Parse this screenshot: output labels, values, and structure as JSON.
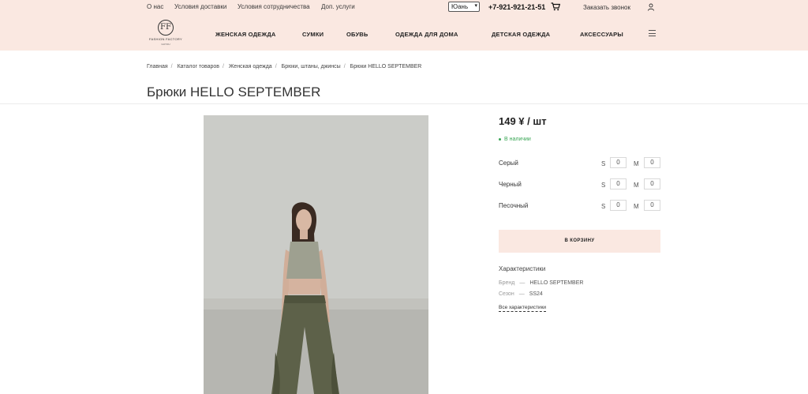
{
  "topbar": {
    "links": [
      "О нас",
      "Условия доставки",
      "Условия сотрудничества",
      "Доп. услуги"
    ],
    "currency": "Юань",
    "phone": "+7-921-921-21-51",
    "callback": "Заказать звонок"
  },
  "logo": {
    "mark": "FF",
    "name": "FASHION FACTORY",
    "sub": "GUYOU"
  },
  "nav": {
    "items": [
      "ЖЕНСКАЯ ОДЕЖДА",
      "СУМКИ",
      "ОБУВЬ",
      "ОДЕЖДА ДЛЯ ДОМА",
      "ДЕТСКАЯ ОДЕЖДА",
      "АКСЕССУАРЫ"
    ]
  },
  "breadcrumb": [
    "Главная",
    "Каталог товаров",
    "Женская одежда",
    "Брюки, штаны, джинсы",
    "Брюки HELLO SEPTEMBER"
  ],
  "product": {
    "title": "Брюки HELLO SEPTEMBER",
    "price": "149 ¥ / шт",
    "stock": "В наличии",
    "variants": [
      {
        "color": "Серый",
        "sizes": [
          {
            "label": "S",
            "qty": "0"
          },
          {
            "label": "M",
            "qty": "0"
          }
        ]
      },
      {
        "color": "Черный",
        "sizes": [
          {
            "label": "S",
            "qty": "0"
          },
          {
            "label": "M",
            "qty": "0"
          }
        ]
      },
      {
        "color": "Песочный",
        "sizes": [
          {
            "label": "S",
            "qty": "0"
          },
          {
            "label": "M",
            "qty": "0"
          }
        ]
      }
    ],
    "cart_button": "В КОРЗИНУ",
    "characteristics": {
      "title": "Характеристики",
      "rows": [
        {
          "key": "Бренд",
          "value": "HELLO SEPTEMBER"
        },
        {
          "key": "Сезон",
          "value": "SS24"
        }
      ],
      "all_link": "Все характеристики"
    }
  },
  "colors": {
    "header_bg": "#fae8e1",
    "stock_green": "#3aa655",
    "button_bg": "#fae8e1"
  }
}
